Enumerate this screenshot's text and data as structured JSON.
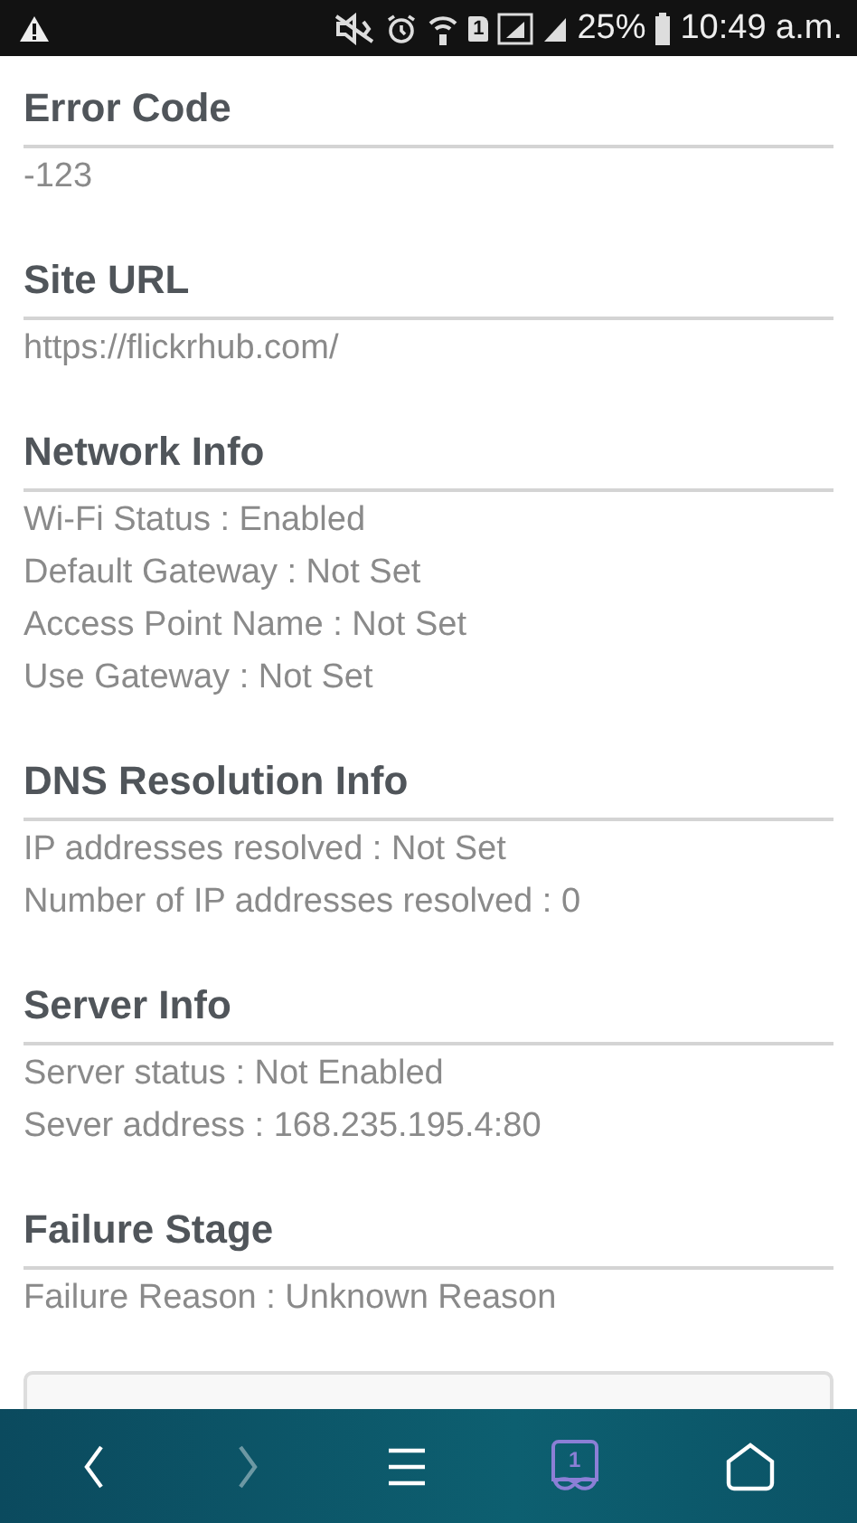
{
  "status_bar": {
    "sim_label": "1",
    "battery": "25%",
    "time": "10:49 a.m."
  },
  "sections": [
    {
      "title": "Error Code",
      "lines": [
        "-123"
      ]
    },
    {
      "title": "Site URL",
      "lines": [
        "https://flickrhub.com/"
      ]
    },
    {
      "title": "Network Info",
      "lines": [
        "Wi-Fi Status : Enabled",
        "Default Gateway : Not Set",
        "Access Point Name : Not Set",
        "Use Gateway : Not Set"
      ]
    },
    {
      "title": "DNS Resolution Info",
      "lines": [
        "IP addresses resolved : Not Set",
        "Number of IP addresses resolved : 0"
      ]
    },
    {
      "title": "Server Info",
      "lines": [
        "Server status : Not Enabled",
        "Sever address : 168.235.195.4:80"
      ]
    },
    {
      "title": "Failure Stage",
      "lines": [
        "Failure Reason : Unknown Reason"
      ]
    }
  ],
  "nav_bar": {
    "buttons": [
      {
        "kind": "back",
        "disabled": false
      },
      {
        "kind": "forward",
        "disabled": true
      },
      {
        "kind": "menu",
        "disabled": false
      },
      {
        "kind": "tabs",
        "disabled": false,
        "count": "1"
      },
      {
        "kind": "home",
        "disabled": false
      }
    ]
  }
}
